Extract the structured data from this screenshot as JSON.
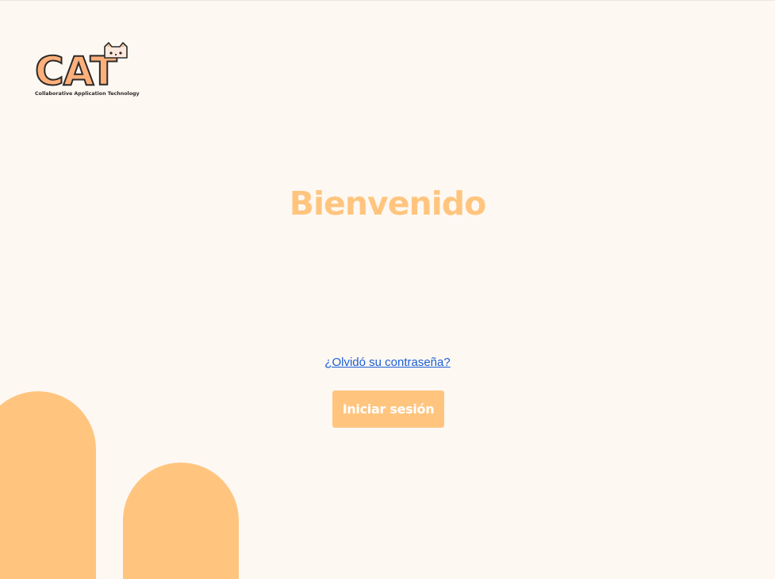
{
  "logo": {
    "wordmark": "CAT",
    "tagline": "Collaborative Application Technology"
  },
  "welcome": {
    "title": "Bienvenido"
  },
  "login": {
    "forgot_password_link": "¿Olvidó su contraseña?",
    "submit_label": "Iniciar sesión"
  },
  "colors": {
    "background": "#fef8f2",
    "accent": "#ffc57f",
    "link": "#1a5fd6"
  }
}
